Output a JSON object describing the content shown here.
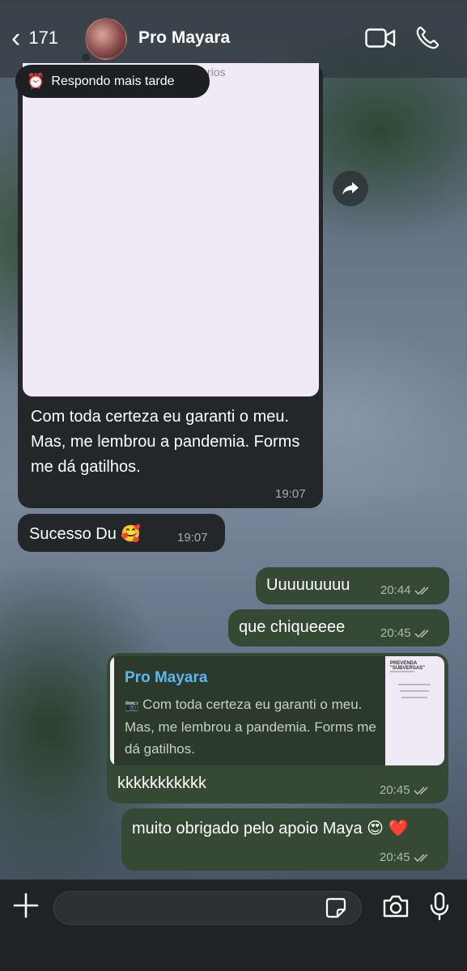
{
  "header": {
    "back_count": "171",
    "contact_name": "Pro Mayara"
  },
  "status": {
    "icon": "⏰",
    "text": "Respondo mais tarde"
  },
  "messages": [
    {
      "direction": "incoming",
      "type": "image",
      "image_fragment": "rios",
      "text": "Com toda certeza eu garanti o meu. Mas, me lembrou a pandemia. Forms me dá gatilhos.",
      "time": "19:07"
    },
    {
      "direction": "incoming",
      "type": "text",
      "text": "Sucesso Du 🥰",
      "time": "19:07"
    },
    {
      "direction": "outgoing",
      "type": "text",
      "text": "Uuuuuuuuu",
      "time": "20:44"
    },
    {
      "direction": "outgoing",
      "type": "text",
      "text": "que chiqueeee",
      "time": "20:45"
    },
    {
      "direction": "outgoing",
      "type": "reply",
      "quote_author": "Pro Mayara",
      "quote_icon": "📷",
      "quote_text": "Com toda certeza eu garanti o meu. Mas, me lembrou a pandemia. Forms me dá gatilhos.",
      "text": "kkkkkkkkkkk",
      "time": "20:45"
    },
    {
      "direction": "outgoing",
      "type": "text",
      "text": "muito obrigado pelo apoio Maya 😍 ❤️",
      "time": "20:45"
    }
  ],
  "thumb": {
    "heading": "PREVENDA \"SUBVERSAS\""
  },
  "colors": {
    "incoming_bubble": "#232729",
    "outgoing_bubble": "#364935",
    "quote_name": "#5bb7f0"
  }
}
